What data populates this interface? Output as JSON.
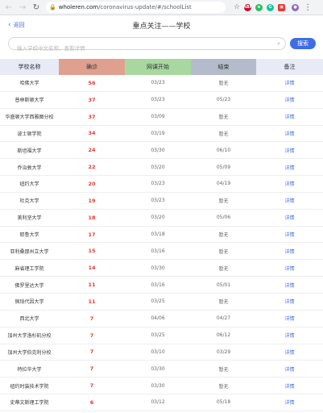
{
  "browser": {
    "url_host": "wholeren.com",
    "url_path": "/coronavirus-update/#/schoolList"
  },
  "header": {
    "back_label": "返回",
    "title": "重点关注——学校"
  },
  "search": {
    "placeholder": "输入学校中文名称，查看详情",
    "button_label": "搜索"
  },
  "table": {
    "columns": [
      {
        "label": "学校名称",
        "bg": "#e8eaf6"
      },
      {
        "label": "确诊",
        "bg": "#e0a090"
      },
      {
        "label": "网课开始",
        "bg": "#a8d8a0"
      },
      {
        "label": "结束",
        "bg": "#b4bccc"
      },
      {
        "label": "备注",
        "bg": "#e8eaf6"
      }
    ],
    "rows": [
      {
        "name": "哈佛大学",
        "confirmed": "56",
        "start": "03/23",
        "end": "暂无",
        "note": "详情"
      },
      {
        "name": "普林斯顿大学",
        "confirmed": "37",
        "start": "03/23",
        "end": "05/23",
        "note": "详情"
      },
      {
        "name": "华盛顿大学西雅图分校",
        "confirmed": "37",
        "start": "03/09",
        "end": "暂无",
        "note": "详情"
      },
      {
        "name": "波士顿学院",
        "confirmed": "34",
        "start": "03/19",
        "end": "暂无",
        "note": "详情"
      },
      {
        "name": "斯坦福大学",
        "confirmed": "24",
        "start": "03/30",
        "end": "06/10",
        "note": "详情"
      },
      {
        "name": "乔治敦大学",
        "confirmed": "22",
        "start": "03/20",
        "end": "05/09",
        "note": "详情"
      },
      {
        "name": "纽约大学",
        "confirmed": "20",
        "start": "03/23",
        "end": "04/19",
        "note": "详情"
      },
      {
        "name": "杜克大学",
        "confirmed": "19",
        "start": "03/23",
        "end": "暂无",
        "note": "详情"
      },
      {
        "name": "美利坚大学",
        "confirmed": "18",
        "start": "03/20",
        "end": "05/06",
        "note": "详情"
      },
      {
        "name": "耶鲁大学",
        "confirmed": "17",
        "start": "03/18",
        "end": "暂无",
        "note": "详情"
      },
      {
        "name": "亚利桑那州立大学",
        "confirmed": "15",
        "start": "03/16",
        "end": "暂无",
        "note": "详情"
      },
      {
        "name": "麻省理工学院",
        "confirmed": "14",
        "start": "03/30",
        "end": "暂无",
        "note": "详情"
      },
      {
        "name": "佛罗里达大学",
        "confirmed": "11",
        "start": "03/16",
        "end": "05/01",
        "note": "详情"
      },
      {
        "name": "佩珀代因大学",
        "confirmed": "11",
        "start": "03/25",
        "end": "暂无",
        "note": "详情"
      },
      {
        "name": "西北大学",
        "confirmed": "7",
        "start": "04/06",
        "end": "04/27",
        "note": "详情"
      },
      {
        "name": "加州大学洛杉矶分校",
        "confirmed": "7",
        "start": "03/25",
        "end": "06/12",
        "note": "详情"
      },
      {
        "name": "加州大学伯克利分校",
        "confirmed": "7",
        "start": "03/10",
        "end": "03/29",
        "note": "详情"
      },
      {
        "name": "特拉华大学",
        "confirmed": "7",
        "start": "03/30",
        "end": "暂无",
        "note": "详情"
      },
      {
        "name": "纽约时装技术学院",
        "confirmed": "7",
        "start": "03/30",
        "end": "暂无",
        "note": "详情"
      },
      {
        "name": "史蒂文斯理工学院",
        "confirmed": "6",
        "start": "03/12",
        "end": "05/18",
        "note": "详情"
      }
    ]
  }
}
